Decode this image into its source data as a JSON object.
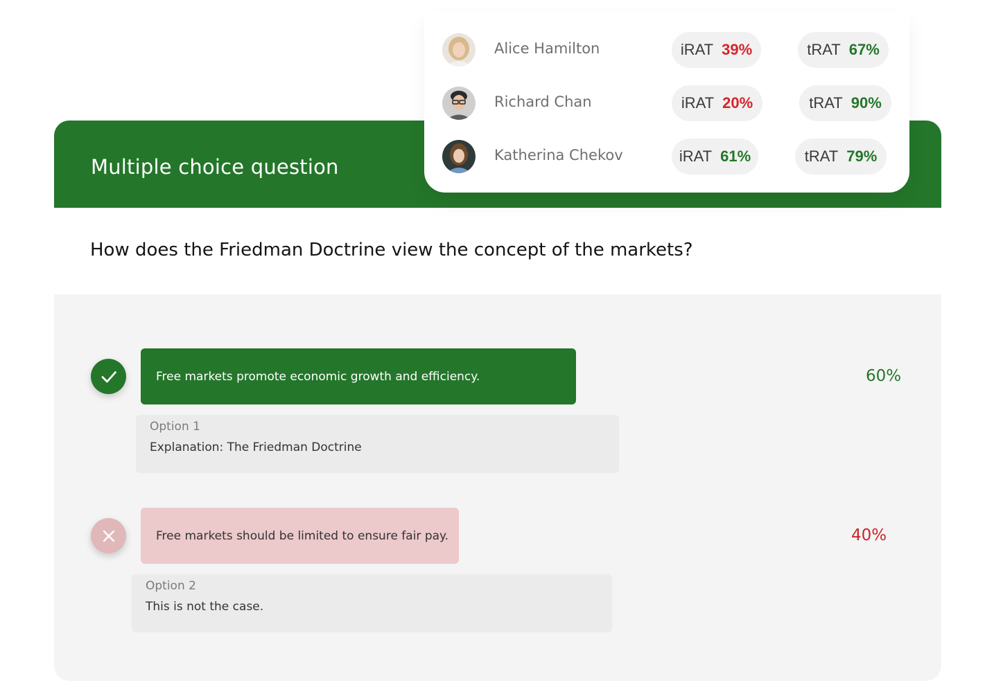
{
  "header": {
    "title": "Multiple choice question"
  },
  "students": [
    {
      "name": "Alice Hamilton",
      "irat_label": "iRAT",
      "irat": "39%",
      "irat_status": "low",
      "trat_label": "tRAT",
      "trat": "67%",
      "trat_status": "high"
    },
    {
      "name": "Richard Chan",
      "irat_label": "iRAT",
      "irat": "20%",
      "irat_status": "low",
      "trat_label": "tRAT",
      "trat": "90%",
      "trat_status": "high"
    },
    {
      "name": "Katherina Chekov",
      "irat_label": "iRAT",
      "irat": "61%",
      "irat_status": "high",
      "trat_label": "tRAT",
      "trat": "79%",
      "trat_status": "high"
    }
  ],
  "question": {
    "text": "How does the Friedman Doctrine view the concept of the markets?"
  },
  "options": [
    {
      "status": "correct",
      "icon": "check-icon",
      "text": "Free markets promote economic growth and efficiency.",
      "percent": "60%",
      "explanation_label": "Option 1",
      "explanation": "Explanation: The Friedman Doctrine"
    },
    {
      "status": "incorrect",
      "icon": "close-icon",
      "text": "Free markets should be limited to ensure fair pay.",
      "percent": "40%",
      "explanation_label": "Option 2",
      "explanation": "This is not the case."
    }
  ],
  "colors": {
    "brand_green": "#24762a",
    "error_red": "#d6242c",
    "wrong_bg": "#ecc9cb",
    "panel_bg": "#f4f4f4"
  }
}
